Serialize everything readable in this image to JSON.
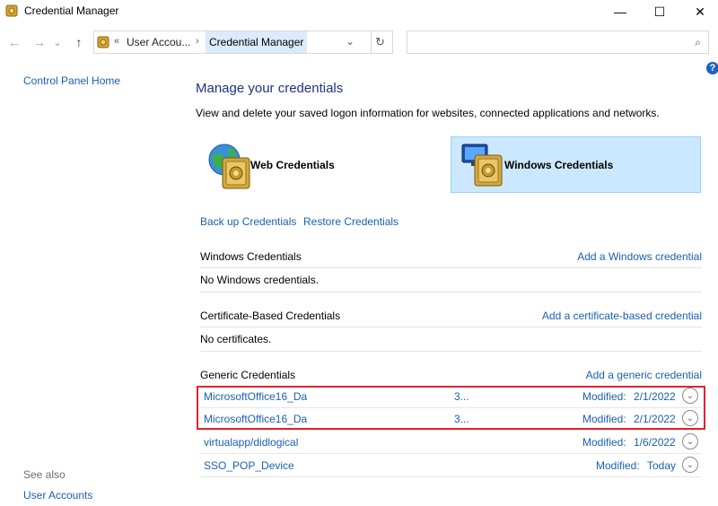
{
  "window": {
    "title": "Credential Manager",
    "controls": {
      "minimize": "—",
      "maximize": "☐",
      "close": "✕"
    }
  },
  "nav": {
    "back": "←",
    "forward": "→",
    "recent": "⌄",
    "up": "↑",
    "breadcrumb_chevron": "«",
    "breadcrumb": [
      "User Accou...",
      "Credential Manager"
    ],
    "separator": "›",
    "dropdown": "⌄",
    "refresh": "↻",
    "search_placeholder": "",
    "search_icon": "⌕",
    "help": "?"
  },
  "left_pane": {
    "home_link": "Control Panel Home",
    "see_also": "See also",
    "see_also_link": "User Accounts"
  },
  "main": {
    "title": "Manage your credentials",
    "description": "View and delete your saved logon information for websites, connected applications and networks.",
    "tiles": [
      {
        "label": "Web Credentials",
        "icon": "globe-safe-icon",
        "selected": false
      },
      {
        "label": "Windows Credentials",
        "icon": "monitor-safe-icon",
        "selected": true
      }
    ],
    "backup_link": "Back up Credentials",
    "restore_link": "Restore Credentials",
    "sections": [
      {
        "title": "Windows Credentials",
        "action": "Add a Windows credential",
        "empty": "No Windows credentials."
      },
      {
        "title": "Certificate-Based Credentials",
        "action": "Add a certificate-based credential",
        "empty": "No certificates."
      },
      {
        "title": "Generic Credentials",
        "action": "Add a generic credential"
      }
    ],
    "generic_items": [
      {
        "name": "MicrosoftOffice16_Da",
        "tail": "3...",
        "modified_label": "Modified:",
        "modified": "2/1/2022"
      },
      {
        "name": "MicrosoftOffice16_Da",
        "tail": "3...",
        "modified_label": "Modified:",
        "modified": "2/1/2022"
      },
      {
        "name": "virtualapp/didlogical",
        "tail": "",
        "modified_label": "Modified:",
        "modified": "1/6/2022"
      },
      {
        "name": "SSO_POP_Device",
        "tail": "",
        "modified_label": "Modified:",
        "modified": "Today"
      }
    ],
    "expand_glyph": "⌄"
  },
  "colors": {
    "link": "#1a5fb4",
    "title": "#1e3287",
    "highlight": "#e0232e",
    "selected_tile": "#cce8ff"
  }
}
